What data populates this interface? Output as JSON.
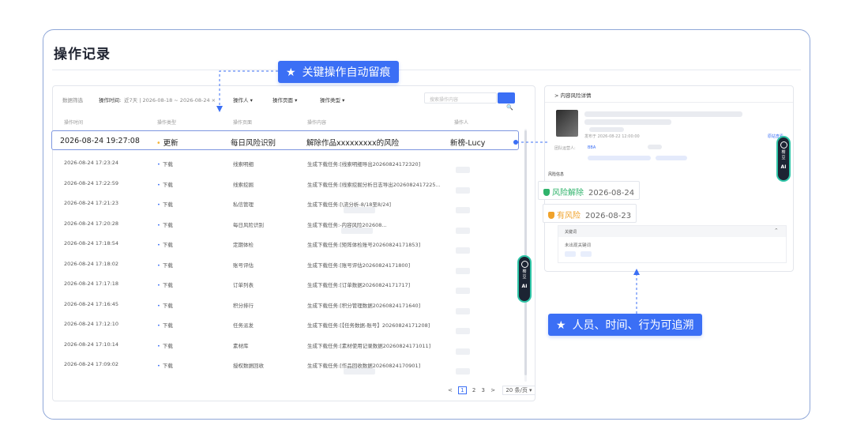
{
  "page": {
    "title": "操作记录"
  },
  "filters": {
    "label": "数据筛选",
    "time_label": "操作时间:",
    "time_value": "近7天 | 2026-08-18 ~ 2026-08-24 ×",
    "operator": "操作人",
    "operate_page": "操作页面",
    "operate_type": "操作类型",
    "caret": "▾",
    "search_placeholder": "搜索操作内容",
    "search_icon": "🔍"
  },
  "table": {
    "headers": [
      "操作时间",
      "操作类型",
      "操作页面",
      "操作内容",
      "操作人"
    ],
    "highlight_row": {
      "time": "2026-08-24 19:27:08",
      "type": "更新",
      "page": "每日风险识别",
      "content": "解除作品xxxxxxxxx的风险",
      "operator": "新榜-Lucy"
    },
    "rows": [
      {
        "time": "2026-08-24 17:23:24",
        "type": "下载",
        "page": "线索明细",
        "content": "生成下载任务:[线索明细导出20260824172320]"
      },
      {
        "time": "2026-08-24 17:22:59",
        "type": "下载",
        "page": "线索挖掘",
        "content": "生成下载任务:[线索挖掘分析日志导出2026082417225..."
      },
      {
        "time": "2026-08-24 17:21:23",
        "type": "下载",
        "page": "私信管理",
        "content_a": "生成下载任务:[",
        "content_b": "\\流分析-8/18至8/24]"
      },
      {
        "time": "2026-08-24 17:20:28",
        "type": "下载",
        "page": "每日风险识别",
        "content_a": "生成下载任务:",
        "content_b": "-内容风险202608..."
      },
      {
        "time": "2026-08-24 17:18:54",
        "type": "下载",
        "page": "定期体检",
        "content": "生成下载任务:[矩阵体检账号20260824171853]"
      },
      {
        "time": "2026-08-24 17:18:02",
        "type": "下载",
        "page": "账号评估",
        "content": "生成下载任务:[账号评估20260824171800]"
      },
      {
        "time": "2026-08-24 17:17:18",
        "type": "下载",
        "page": "订单列表",
        "content": "生成下载任务:[订单数据20260824171717]"
      },
      {
        "time": "2026-08-24 17:16:45",
        "type": "下载",
        "page": "积分排行",
        "content": "生成下载任务:[积分管理数据20260824171640]"
      },
      {
        "time": "2026-08-24 17:12:10",
        "type": "下载",
        "page": "任务派发",
        "content": "生成下载任务:[【任务数据-账号】20260824171208]"
      },
      {
        "time": "2026-08-24 17:10:14",
        "type": "下载",
        "page": "素材库",
        "content": "生成下载任务:[素材使用记录数据20260824171011]"
      },
      {
        "time": "2026-08-24 17:09:02",
        "type": "下载",
        "page": "授权数据回收",
        "content_a": "生成下载任务:[",
        "content_b": "作品回收数据20260824170901]"
      }
    ],
    "dot": "•"
  },
  "pagination": {
    "prev": "<",
    "pages": [
      "1",
      "2",
      "3"
    ],
    "next": ">",
    "page_size": "20 条/页 ▾"
  },
  "detail": {
    "title": "> 内容风险详情",
    "published_at": "发布于 2026-08-22 12:00:00",
    "view_link": "原站查看",
    "team_label": "团队运营人:",
    "team_value": "BBA",
    "risk_header": "风险信息",
    "keyword_header": "关键词",
    "keyword_caret": "^",
    "keyword_empty": "未出现关键词"
  },
  "badges": {
    "resolved_label": "风险解除",
    "resolved_date": "2026-08-24",
    "risk_label": "有风险",
    "risk_date": "2026-08-23"
  },
  "ai_widget": {
    "line1": "樱",
    "line2": "豆",
    "ai": "AI"
  },
  "callouts": {
    "top": "关键操作自动留痕",
    "bottom": "人员、时间、行为可追溯",
    "star": "★"
  },
  "colors": {
    "accent": "#3b6ff5",
    "ok": "#2fb36b",
    "warn": "#f0a22a",
    "frame": "#8fa7d8"
  }
}
